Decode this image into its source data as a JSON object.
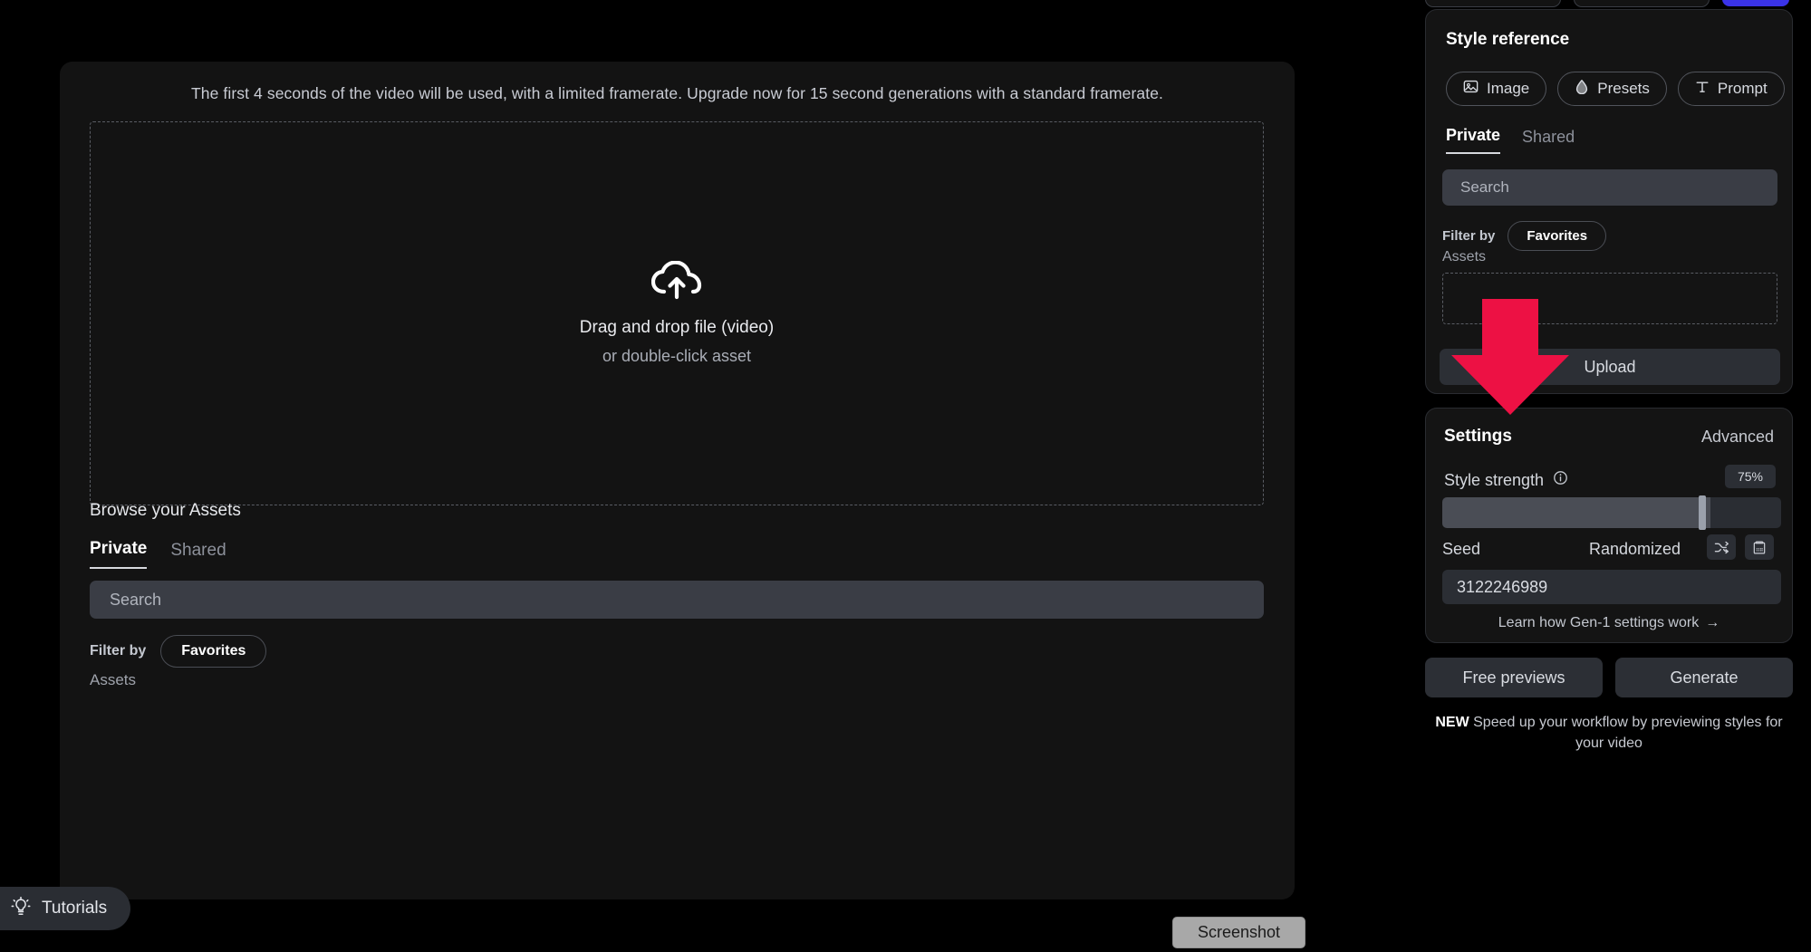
{
  "main": {
    "banner_text": "The first 4 seconds of the video will be used, with a limited framerate. Upgrade now for 15 second generations with a standard framerate.",
    "dropzone": {
      "icon": "cloud-upload-icon",
      "title": "Drag and drop file (video)",
      "subtitle": "or double-click asset"
    },
    "browse_title": "Browse your Assets",
    "tabs": [
      {
        "label": "Private",
        "active": true
      },
      {
        "label": "Shared",
        "active": false
      }
    ],
    "search": {
      "placeholder": "Search",
      "value": ""
    },
    "filter": {
      "label": "Filter by",
      "chip": "Favorites"
    },
    "assets_label": "Assets"
  },
  "tutorials": {
    "icon": "lightbulb-icon",
    "label": "Tutorials"
  },
  "screenshot_button": {
    "label": "Screenshot"
  },
  "sidebar": {
    "style_reference": {
      "title": "Style reference",
      "chips": [
        {
          "label": "Image",
          "icon": "picture-icon"
        },
        {
          "label": "Presets",
          "icon": "droplet-icon"
        },
        {
          "label": "Prompt",
          "icon": "text-t-icon"
        }
      ],
      "tabs": [
        {
          "label": "Private",
          "active": true
        },
        {
          "label": "Shared",
          "active": false
        }
      ],
      "search": {
        "placeholder": "Search",
        "value": ""
      },
      "filter": {
        "label": "Filter by",
        "chip": "Favorites"
      },
      "assets_label": "Assets",
      "upload_label": "Upload"
    },
    "settings": {
      "title": "Settings",
      "advanced_label": "Advanced",
      "style_strength": {
        "label": "Style strength",
        "info_icon": "info-icon",
        "value": "75%",
        "percent": 75
      },
      "seed": {
        "label": "Seed",
        "mode": "Randomized",
        "shuffle_icon": "shuffle-icon",
        "copy_icon": "clipboard-icon",
        "value": "3122246989"
      },
      "learn_link": "Learn how Gen-1 settings work",
      "learn_arrow": "→"
    },
    "actions": {
      "free_previews": "Free previews",
      "generate": "Generate"
    },
    "new_note": {
      "badge": "NEW",
      "text": " Speed up your workflow by previewing styles for your video"
    }
  },
  "annotation": {
    "arrow_color": "#ed1144",
    "icon": "down-arrow-annotation"
  },
  "colors": {
    "background": "#000000",
    "panel": "#131313",
    "card": "#141414",
    "input": "#3a3d45",
    "button": "#2c2f35",
    "accent_blue": "#3a33e8",
    "annotation_red": "#ed1144"
  }
}
